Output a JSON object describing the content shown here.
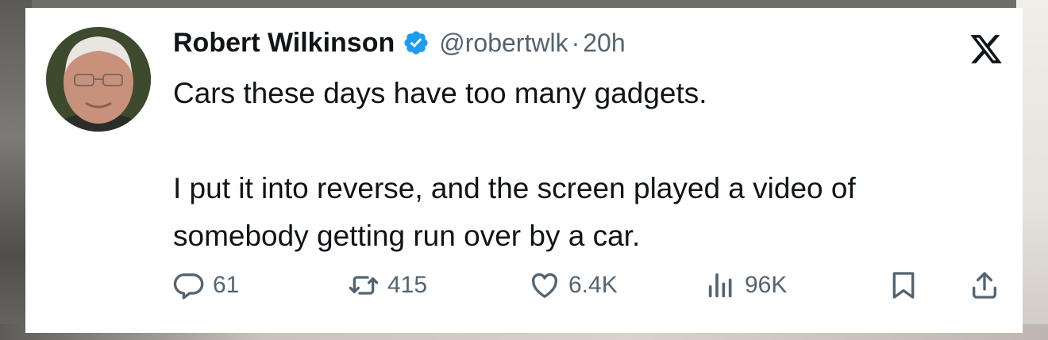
{
  "tweet": {
    "author_name": "Robert Wilkinson",
    "handle": "@robertwlk",
    "separator": "·",
    "time": "20h",
    "text_lines": [
      "Cars these days have too many gadgets.",
      "I put it into reverse, and the screen played a video of",
      "somebody getting run over by a car."
    ]
  },
  "metrics": {
    "replies": "61",
    "reposts": "415",
    "likes": "6.4K",
    "views": "96K"
  },
  "icons": {
    "verified": "verified-badge-icon",
    "platform": "x-logo-icon",
    "reply": "reply-bubble-icon",
    "repost": "repost-arrows-icon",
    "like": "heart-icon",
    "views": "bar-chart-icon",
    "bookmark": "bookmark-icon",
    "share": "share-upload-icon"
  },
  "colors": {
    "text": "#0f1419",
    "secondary": "#536471",
    "verified": "#1d9bf0"
  }
}
